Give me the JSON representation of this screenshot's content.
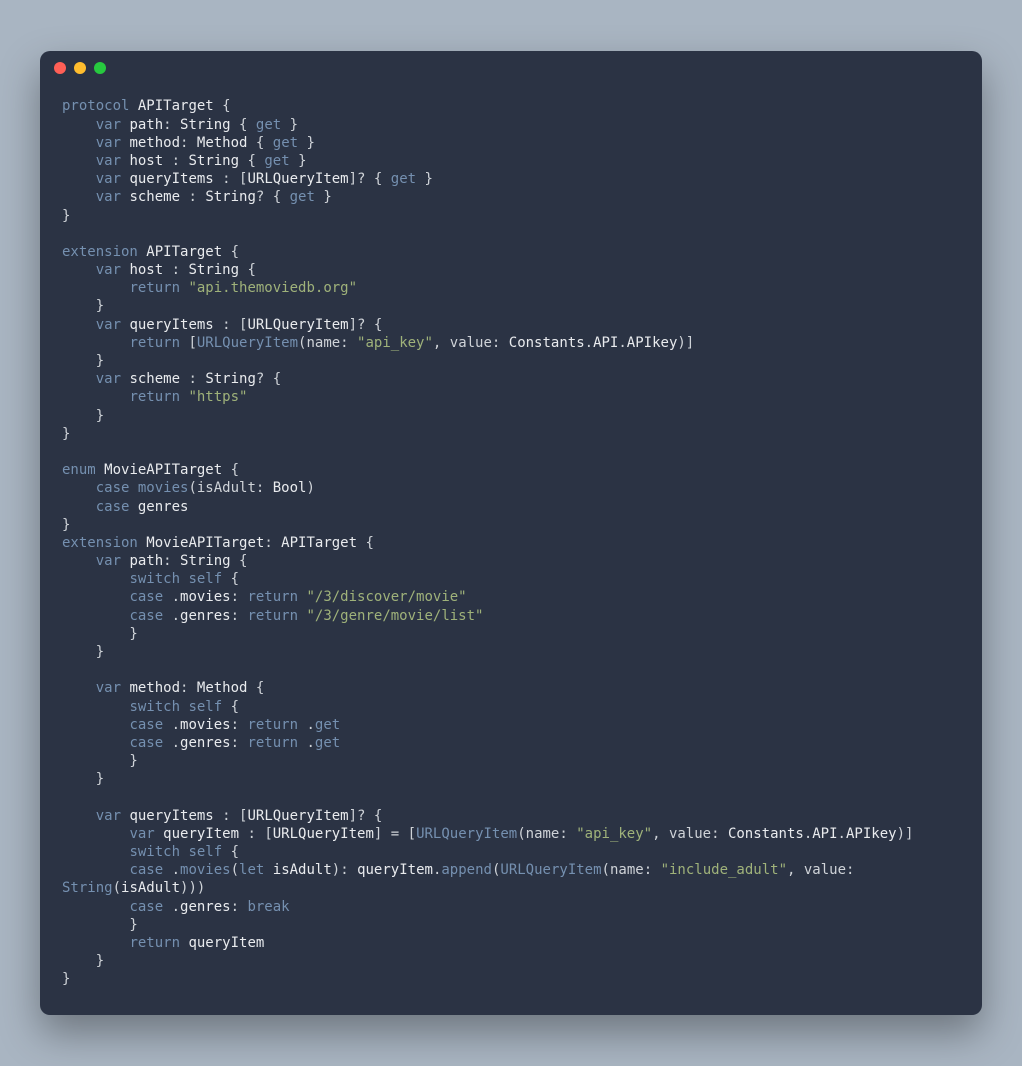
{
  "window": {
    "traffic_lights": [
      "close",
      "minimize",
      "zoom"
    ]
  },
  "code": {
    "lines": [
      [
        [
          "kw",
          "protocol"
        ],
        [
          "pl",
          " "
        ],
        [
          "ty",
          "APITarget"
        ],
        [
          "pl",
          " {"
        ]
      ],
      [
        [
          "pl",
          "    "
        ],
        [
          "kw",
          "var"
        ],
        [
          "pl",
          " "
        ],
        [
          "id",
          "path"
        ],
        [
          "pl",
          ": "
        ],
        [
          "ty",
          "String"
        ],
        [
          "pl",
          " { "
        ],
        [
          "kw",
          "get"
        ],
        [
          "pl",
          " }"
        ]
      ],
      [
        [
          "pl",
          "    "
        ],
        [
          "kw",
          "var"
        ],
        [
          "pl",
          " "
        ],
        [
          "id",
          "method"
        ],
        [
          "pl",
          ": "
        ],
        [
          "ty",
          "Method"
        ],
        [
          "pl",
          " { "
        ],
        [
          "kw",
          "get"
        ],
        [
          "pl",
          " }"
        ]
      ],
      [
        [
          "pl",
          "    "
        ],
        [
          "kw",
          "var"
        ],
        [
          "pl",
          " "
        ],
        [
          "id",
          "host"
        ],
        [
          "pl",
          " : "
        ],
        [
          "ty",
          "String"
        ],
        [
          "pl",
          " { "
        ],
        [
          "kw",
          "get"
        ],
        [
          "pl",
          " }"
        ]
      ],
      [
        [
          "pl",
          "    "
        ],
        [
          "kw",
          "var"
        ],
        [
          "pl",
          " "
        ],
        [
          "id",
          "queryItems"
        ],
        [
          "pl",
          " : ["
        ],
        [
          "ty",
          "URLQueryItem"
        ],
        [
          "pl",
          "]? { "
        ],
        [
          "kw",
          "get"
        ],
        [
          "pl",
          " }"
        ]
      ],
      [
        [
          "pl",
          "    "
        ],
        [
          "kw",
          "var"
        ],
        [
          "pl",
          " "
        ],
        [
          "id",
          "scheme"
        ],
        [
          "pl",
          " : "
        ],
        [
          "ty",
          "String"
        ],
        [
          "pl",
          "? { "
        ],
        [
          "kw",
          "get"
        ],
        [
          "pl",
          " }"
        ]
      ],
      [
        [
          "pl",
          "}"
        ]
      ],
      [
        [
          "pl",
          ""
        ]
      ],
      [
        [
          "kw",
          "extension"
        ],
        [
          "pl",
          " "
        ],
        [
          "ty",
          "APITarget"
        ],
        [
          "pl",
          " {"
        ]
      ],
      [
        [
          "pl",
          "    "
        ],
        [
          "kw",
          "var"
        ],
        [
          "pl",
          " "
        ],
        [
          "id",
          "host"
        ],
        [
          "pl",
          " : "
        ],
        [
          "ty",
          "String"
        ],
        [
          "pl",
          " {"
        ]
      ],
      [
        [
          "pl",
          "        "
        ],
        [
          "kw",
          "return"
        ],
        [
          "pl",
          " "
        ],
        [
          "st",
          "\"api.themoviedb.org\""
        ]
      ],
      [
        [
          "pl",
          "    }"
        ]
      ],
      [
        [
          "pl",
          "    "
        ],
        [
          "kw",
          "var"
        ],
        [
          "pl",
          " "
        ],
        [
          "id",
          "queryItems"
        ],
        [
          "pl",
          " : ["
        ],
        [
          "ty",
          "URLQueryItem"
        ],
        [
          "pl",
          "]? {"
        ]
      ],
      [
        [
          "pl",
          "        "
        ],
        [
          "kw",
          "return"
        ],
        [
          "pl",
          " ["
        ],
        [
          "fn",
          "URLQueryItem"
        ],
        [
          "pl",
          "(name: "
        ],
        [
          "st",
          "\"api_key\""
        ],
        [
          "pl",
          ", value: "
        ],
        [
          "ty",
          "Constants"
        ],
        [
          "pl",
          "."
        ],
        [
          "ty",
          "API"
        ],
        [
          "pl",
          "."
        ],
        [
          "id",
          "APIkey"
        ],
        [
          "pl",
          ")]"
        ]
      ],
      [
        [
          "pl",
          "    }"
        ]
      ],
      [
        [
          "pl",
          "    "
        ],
        [
          "kw",
          "var"
        ],
        [
          "pl",
          " "
        ],
        [
          "id",
          "scheme"
        ],
        [
          "pl",
          " : "
        ],
        [
          "ty",
          "String"
        ],
        [
          "pl",
          "? {"
        ]
      ],
      [
        [
          "pl",
          "        "
        ],
        [
          "kw",
          "return"
        ],
        [
          "pl",
          " "
        ],
        [
          "st",
          "\"https\""
        ]
      ],
      [
        [
          "pl",
          "    }"
        ]
      ],
      [
        [
          "pl",
          "}"
        ]
      ],
      [
        [
          "pl",
          ""
        ]
      ],
      [
        [
          "kw",
          "enum"
        ],
        [
          "pl",
          " "
        ],
        [
          "ty",
          "MovieAPITarget"
        ],
        [
          "pl",
          " {"
        ]
      ],
      [
        [
          "pl",
          "    "
        ],
        [
          "kw",
          "case"
        ],
        [
          "pl",
          " "
        ],
        [
          "fn",
          "movies"
        ],
        [
          "pl",
          "(isAdult: "
        ],
        [
          "ty",
          "Bool"
        ],
        [
          "pl",
          ")"
        ]
      ],
      [
        [
          "pl",
          "    "
        ],
        [
          "kw",
          "case"
        ],
        [
          "pl",
          " "
        ],
        [
          "id",
          "genres"
        ]
      ],
      [
        [
          "pl",
          "}"
        ]
      ],
      [
        [
          "kw",
          "extension"
        ],
        [
          "pl",
          " "
        ],
        [
          "ty",
          "MovieAPITarget"
        ],
        [
          "pl",
          ": "
        ],
        [
          "ty",
          "APITarget"
        ],
        [
          "pl",
          " {"
        ]
      ],
      [
        [
          "pl",
          "    "
        ],
        [
          "kw",
          "var"
        ],
        [
          "pl",
          " "
        ],
        [
          "id",
          "path"
        ],
        [
          "pl",
          ": "
        ],
        [
          "ty",
          "String"
        ],
        [
          "pl",
          " {"
        ]
      ],
      [
        [
          "pl",
          "        "
        ],
        [
          "kw",
          "switch"
        ],
        [
          "pl",
          " "
        ],
        [
          "kw",
          "self"
        ],
        [
          "pl",
          " {"
        ]
      ],
      [
        [
          "pl",
          "        "
        ],
        [
          "kw",
          "case"
        ],
        [
          "pl",
          " ."
        ],
        [
          "id",
          "movies"
        ],
        [
          "pl",
          ": "
        ],
        [
          "kw",
          "return"
        ],
        [
          "pl",
          " "
        ],
        [
          "st",
          "\"/3/discover/movie\""
        ]
      ],
      [
        [
          "pl",
          "        "
        ],
        [
          "kw",
          "case"
        ],
        [
          "pl",
          " ."
        ],
        [
          "id",
          "genres"
        ],
        [
          "pl",
          ": "
        ],
        [
          "kw",
          "return"
        ],
        [
          "pl",
          " "
        ],
        [
          "st",
          "\"/3/genre/movie/list\""
        ]
      ],
      [
        [
          "pl",
          "        }"
        ]
      ],
      [
        [
          "pl",
          "    }"
        ]
      ],
      [
        [
          "pl",
          ""
        ]
      ],
      [
        [
          "pl",
          "    "
        ],
        [
          "kw",
          "var"
        ],
        [
          "pl",
          " "
        ],
        [
          "id",
          "method"
        ],
        [
          "pl",
          ": "
        ],
        [
          "ty",
          "Method"
        ],
        [
          "pl",
          " {"
        ]
      ],
      [
        [
          "pl",
          "        "
        ],
        [
          "kw",
          "switch"
        ],
        [
          "pl",
          " "
        ],
        [
          "kw",
          "self"
        ],
        [
          "pl",
          " {"
        ]
      ],
      [
        [
          "pl",
          "        "
        ],
        [
          "kw",
          "case"
        ],
        [
          "pl",
          " ."
        ],
        [
          "id",
          "movies"
        ],
        [
          "pl",
          ": "
        ],
        [
          "kw",
          "return"
        ],
        [
          "pl",
          " ."
        ],
        [
          "kw",
          "get"
        ]
      ],
      [
        [
          "pl",
          "        "
        ],
        [
          "kw",
          "case"
        ],
        [
          "pl",
          " ."
        ],
        [
          "id",
          "genres"
        ],
        [
          "pl",
          ": "
        ],
        [
          "kw",
          "return"
        ],
        [
          "pl",
          " ."
        ],
        [
          "kw",
          "get"
        ]
      ],
      [
        [
          "pl",
          "        }"
        ]
      ],
      [
        [
          "pl",
          "    }"
        ]
      ],
      [
        [
          "pl",
          ""
        ]
      ],
      [
        [
          "pl",
          "    "
        ],
        [
          "kw",
          "var"
        ],
        [
          "pl",
          " "
        ],
        [
          "id",
          "queryItems"
        ],
        [
          "pl",
          " : ["
        ],
        [
          "ty",
          "URLQueryItem"
        ],
        [
          "pl",
          "]? {"
        ]
      ],
      [
        [
          "pl",
          "        "
        ],
        [
          "kw",
          "var"
        ],
        [
          "pl",
          " "
        ],
        [
          "id",
          "queryItem"
        ],
        [
          "pl",
          " : ["
        ],
        [
          "ty",
          "URLQueryItem"
        ],
        [
          "pl",
          "] = ["
        ],
        [
          "fn",
          "URLQueryItem"
        ],
        [
          "pl",
          "(name: "
        ],
        [
          "st",
          "\"api_key\""
        ],
        [
          "pl",
          ", value: "
        ],
        [
          "ty",
          "Constants"
        ],
        [
          "pl",
          "."
        ],
        [
          "ty",
          "API"
        ],
        [
          "pl",
          "."
        ],
        [
          "id",
          "APIkey"
        ],
        [
          "pl",
          ")]"
        ]
      ],
      [
        [
          "pl",
          "        "
        ],
        [
          "kw",
          "switch"
        ],
        [
          "pl",
          " "
        ],
        [
          "kw",
          "self"
        ],
        [
          "pl",
          " {"
        ]
      ],
      [
        [
          "pl",
          "        "
        ],
        [
          "kw",
          "case"
        ],
        [
          "pl",
          " ."
        ],
        [
          "fn",
          "movies"
        ],
        [
          "pl",
          "("
        ],
        [
          "kw",
          "let"
        ],
        [
          "pl",
          " "
        ],
        [
          "id",
          "isAdult"
        ],
        [
          "pl",
          "): "
        ],
        [
          "id",
          "queryItem"
        ],
        [
          "pl",
          "."
        ],
        [
          "fn",
          "append"
        ],
        [
          "pl",
          "("
        ],
        [
          "fn",
          "URLQueryItem"
        ],
        [
          "pl",
          "(name: "
        ],
        [
          "st",
          "\"include_adult\""
        ],
        [
          "pl",
          ", value: "
        ]
      ],
      [
        [
          "fn",
          "String"
        ],
        [
          "pl",
          "("
        ],
        [
          "id",
          "isAdult"
        ],
        [
          "pl",
          ")))"
        ]
      ],
      [
        [
          "pl",
          "        "
        ],
        [
          "kw",
          "case"
        ],
        [
          "pl",
          " ."
        ],
        [
          "id",
          "genres"
        ],
        [
          "pl",
          ": "
        ],
        [
          "kw",
          "break"
        ]
      ],
      [
        [
          "pl",
          "        }"
        ]
      ],
      [
        [
          "pl",
          "        "
        ],
        [
          "kw",
          "return"
        ],
        [
          "pl",
          " "
        ],
        [
          "id",
          "queryItem"
        ]
      ],
      [
        [
          "pl",
          "    }"
        ]
      ],
      [
        [
          "pl",
          "}"
        ]
      ]
    ]
  }
}
